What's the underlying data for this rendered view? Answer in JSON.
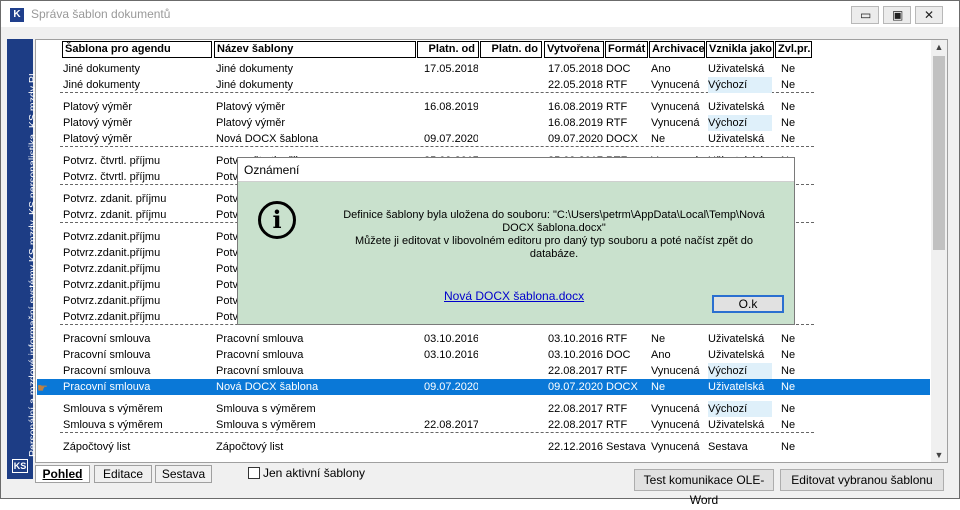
{
  "window": {
    "title": "Správa šablon dokumentů",
    "min_glyph": "▭",
    "max_glyph": "▣",
    "close_glyph": "✕",
    "icon_glyph": "K"
  },
  "sidebar": {
    "text": "Personální a mzdové informační systémy KS mzdy, KS personalistika, KS mzdy PI",
    "logo": "KS"
  },
  "table": {
    "headers": [
      "Šablona pro agendu",
      "Název šablony",
      "Platn. od",
      "Platn. do",
      "Vytvořena",
      "Formát",
      "Archivace",
      "Vznikla jako",
      "Zvl.pr."
    ],
    "rows": [
      [
        "Jiné dokumenty",
        "Jiné dokumenty",
        "17.05.2018",
        "",
        "17.05.2018",
        "DOC",
        "Ano",
        "Uživatelská",
        "Ne"
      ],
      [
        "Jiné dokumenty",
        "Jiné dokumenty",
        "",
        "",
        "22.05.2018",
        "RTF",
        "Vynucená",
        "Výchozí",
        "Ne"
      ],
      [
        "Platový výměr",
        "Platový výměr",
        "16.08.2019",
        "",
        "16.08.2019",
        "RTF",
        "Vynucená",
        "Uživatelská",
        "Ne"
      ],
      [
        "Platový výměr",
        "Platový výměr",
        "",
        "",
        "16.08.2019",
        "RTF",
        "Vynucená",
        "Výchozí",
        "Ne"
      ],
      [
        "Platový výměr",
        "Nová DOCX šablona",
        "09.07.2020",
        "",
        "09.07.2020",
        "DOCX",
        "Ne",
        "Uživatelská",
        "Ne"
      ],
      [
        "Potvrz. čtvrtl. příjmu",
        "Potvrz. čtvrtl. příjmu",
        "25.09.2017",
        "",
        "25.09.2017",
        "RTF",
        "Vynucená",
        "Uživatelská",
        "Ne"
      ],
      [
        "Potvrz. čtvrtl. příjmu",
        "Potvrz. čtvrtl. příjmu",
        "",
        "",
        "",
        "",
        "",
        "",
        ""
      ],
      [
        "Potvrz. zdanit. příjmu",
        "Potvrz. zdanit. příjmu",
        "",
        "",
        "",
        "",
        "",
        "",
        ""
      ],
      [
        "Potvrz. zdanit. příjmu",
        "Potvrz. zdanit. příjmu",
        "",
        "",
        "",
        "",
        "",
        "",
        ""
      ],
      [
        "Potvrz.zdanit.příjmu",
        "Potvrz.zdanit.příjmu",
        "",
        "",
        "",
        "",
        "",
        "",
        ""
      ],
      [
        "Potvrz.zdanit.příjmu",
        "Potvrz.zdanit.příjmu",
        "",
        "",
        "",
        "",
        "",
        "",
        ""
      ],
      [
        "Potvrz.zdanit.příjmu",
        "Potvrz.zdanit.příjmu",
        "",
        "",
        "",
        "",
        "",
        "",
        ""
      ],
      [
        "Potvrz.zdanit.příjmu",
        "Potvrz.zdanit.příjmu",
        "",
        "",
        "",
        "",
        "",
        "",
        ""
      ],
      [
        "Potvrz.zdanit.příjmu",
        "Potvrz.zdanit.příjmu",
        "",
        "",
        "",
        "",
        "",
        "",
        ""
      ],
      [
        "Potvrz.zdanit.příjmu",
        "Potvrz.zdanit.příjmu",
        "",
        "",
        "",
        "",
        "",
        "",
        ""
      ],
      [
        "Pracovní smlouva",
        "Pracovní smlouva",
        "03.10.2016",
        "",
        "03.10.2016",
        "RTF",
        "Ne",
        "Uživatelská",
        "Ne"
      ],
      [
        "Pracovní smlouva",
        "Pracovní smlouva",
        "03.10.2016",
        "",
        "03.10.2016",
        "DOC",
        "Ano",
        "Uživatelská",
        "Ne"
      ],
      [
        "Pracovní smlouva",
        "Pracovní smlouva",
        "",
        "",
        "22.08.2017",
        "RTF",
        "Vynucená",
        "Výchozí",
        "Ne"
      ],
      [
        "Pracovní smlouva",
        "Nová DOCX šablona",
        "09.07.2020",
        "",
        "09.07.2020",
        "DOCX",
        "Ne",
        "Uživatelská",
        "Ne"
      ],
      [
        "Smlouva s výměrem",
        "Smlouva s výměrem",
        "",
        "",
        "22.08.2017",
        "RTF",
        "Vynucená",
        "Výchozí",
        "Ne"
      ],
      [
        "Smlouva s výměrem",
        "Smlouva s výměrem",
        "22.08.2017",
        "",
        "22.08.2017",
        "RTF",
        "Vynucená",
        "Uživatelská",
        "Ne"
      ],
      [
        "Zápočtový list",
        "Zápočtový list",
        "",
        "",
        "22.12.2016",
        "Sestava",
        "Vynucená",
        "Sestava",
        "Ne"
      ]
    ],
    "pointer_glyph": "☛"
  },
  "bottom": {
    "tabs": [
      "Pohled",
      "Editace",
      "Sestava"
    ],
    "checkbox_label": "Jen aktivní šablony",
    "test_button": "Test komunikace OLE-Word",
    "edit_button": "Editovat vybranou šablonu"
  },
  "dialog": {
    "title": "Oznámení",
    "icon_glyph": "i",
    "message": "Definice šablony byla uložena do souboru:  \"C:\\Users\\petrm\\AppData\\Local\\Temp\\Nová DOCX šablona.docx\"\nMůžete ji editovat v libovolném editoru pro daný typ souboru a poté načíst zpět do databáze.",
    "link": "Nová DOCX šablona.docx",
    "ok": "O.k"
  },
  "colors": {
    "selection": "#0a78d7",
    "sidebar": "#1d3d85",
    "dialog_bg": "#c9e1cd"
  }
}
